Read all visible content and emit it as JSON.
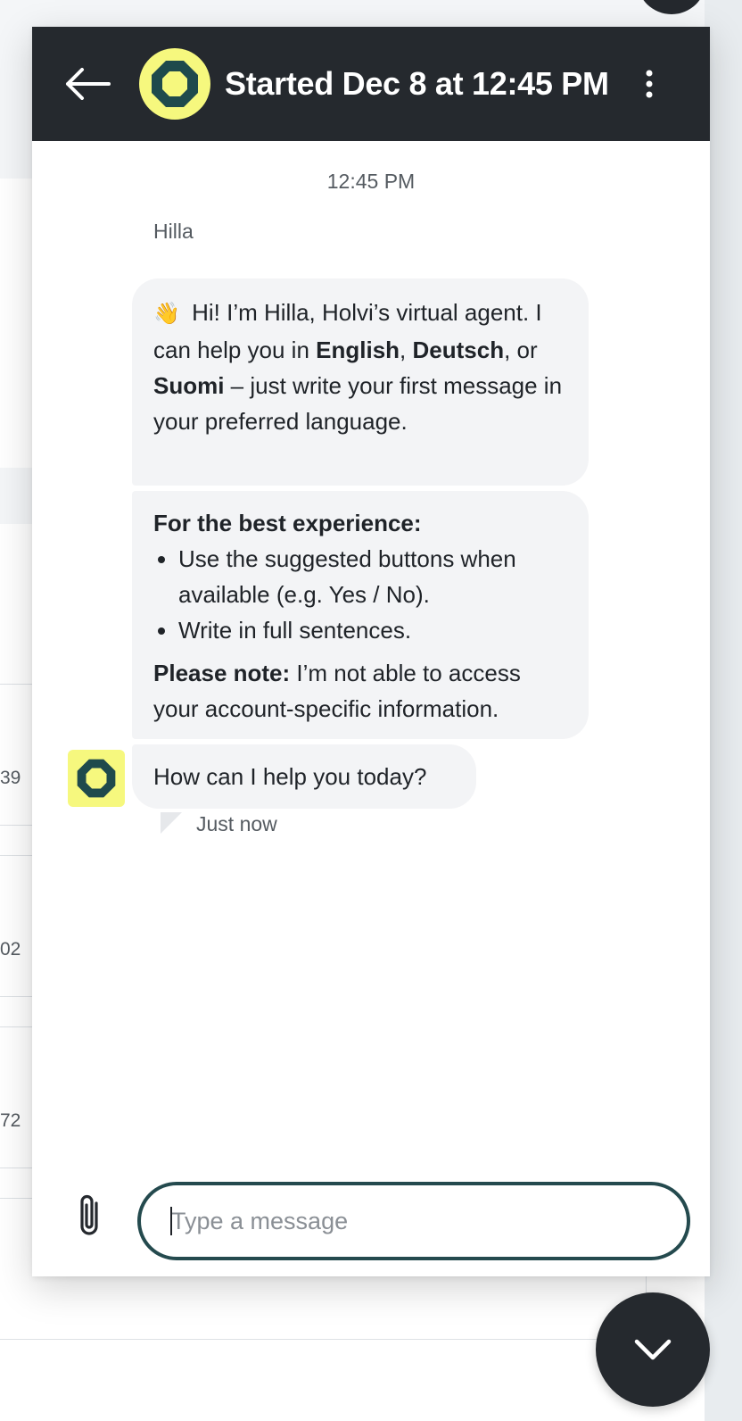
{
  "background": {
    "row_numbers": [
      "39",
      "02",
      "72"
    ]
  },
  "header": {
    "title": "Started Dec 8 at 12:45 PM",
    "back_icon": "arrow-left-icon",
    "menu_icon": "more-vertical-icon",
    "avatar_icon": "holvi-octagon-icon"
  },
  "conversation": {
    "timestamp": "12:45 PM",
    "sender": "Hilla",
    "greeting": {
      "emoji": "👋",
      "text_1": " Hi! I’m Hilla, Holvi’s virtual agent. I can help you in ",
      "lang_1": "English",
      "sep_1": ", ",
      "lang_2": "Deutsch",
      "sep_2": ", or ",
      "lang_3": "Suomi",
      "text_2": " – just write your first message in your preferred language."
    },
    "tips": {
      "heading": "For the best experience:",
      "items": [
        "Use the suggested buttons when available (e.g. Yes / No).",
        "Write in full sentences."
      ],
      "note_label": "Please note:",
      "note_text": " I’m not able to access your account-specific information."
    },
    "question": "How can I help you today?",
    "status": "Just now"
  },
  "composer": {
    "placeholder": "Type a message",
    "value": "",
    "attach_icon": "paperclip-icon"
  },
  "collapse_icon": "chevron-down-icon",
  "colors": {
    "header_bg": "#25292e",
    "avatar_yellow": "#f6f87e",
    "avatar_green": "#1f4a4c",
    "bubble_bg": "#f3f4f6",
    "input_border": "#244a4e"
  }
}
